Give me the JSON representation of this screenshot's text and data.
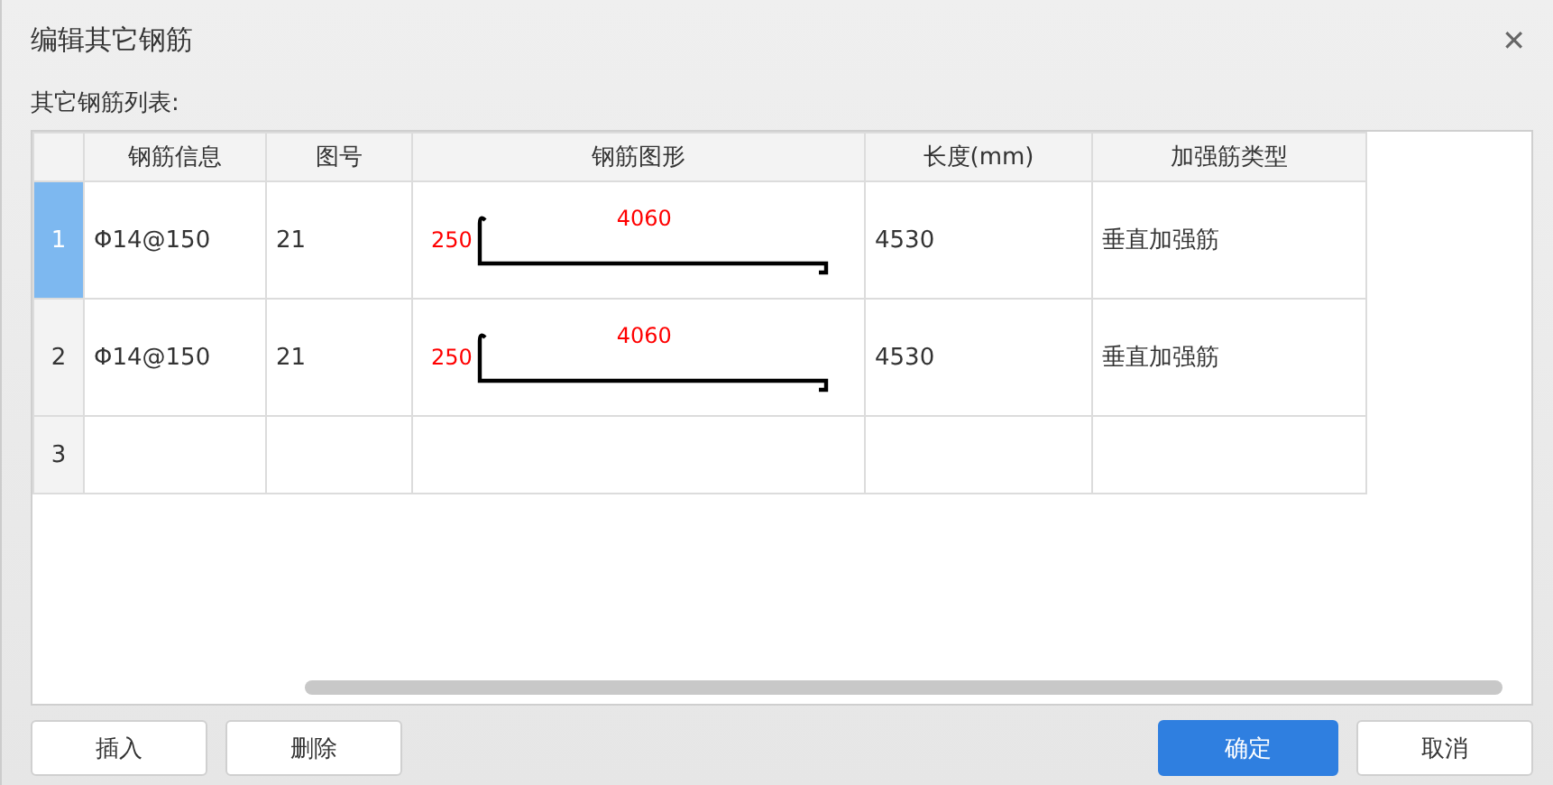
{
  "window": {
    "title": "编辑其它钢筋",
    "close": "✕"
  },
  "list_label": "其它钢筋列表:",
  "table": {
    "columns": [
      "钢筋信息",
      "图号",
      "钢筋图形",
      "长度(mm)",
      "加强筋类型"
    ],
    "rows": [
      {
        "number": "1",
        "selected": true,
        "info": "Φ14@150",
        "figure_no": "21",
        "shape": {
          "left_length": "250",
          "main_length": "4060"
        },
        "length": "4530",
        "type": "垂直加强筋"
      },
      {
        "number": "2",
        "selected": false,
        "info": "Φ14@150",
        "figure_no": "21",
        "shape": {
          "left_length": "250",
          "main_length": "4060"
        },
        "length": "4530",
        "type": "垂直加强筋"
      },
      {
        "number": "3",
        "selected": false
      }
    ]
  },
  "buttons": [
    {
      "label": "插入",
      "kind": "normal"
    },
    {
      "label": "删除",
      "kind": "normal"
    },
    {
      "label": "确定",
      "kind": "primary"
    },
    {
      "label": "取消",
      "kind": "normal"
    }
  ]
}
